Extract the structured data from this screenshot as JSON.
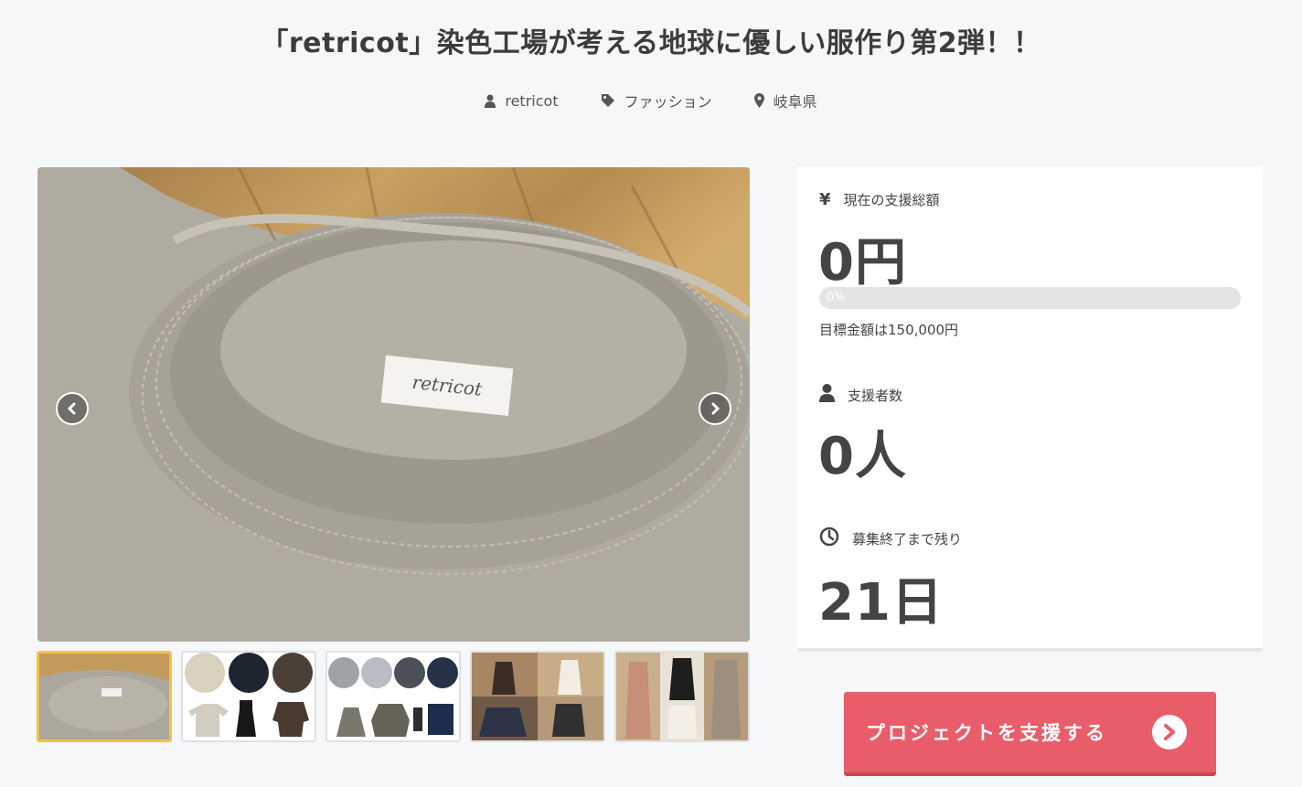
{
  "project": {
    "title": "「retricot」染色工場が考える地球に優しい服作り第2弾！！",
    "owner": "retricot",
    "category": "ファッション",
    "location": "岐阜県"
  },
  "gallery": {
    "label_text": "retricot",
    "prev_icon": "chevron-left-icon",
    "next_icon": "chevron-right-icon",
    "thumbnail_count": 5,
    "active_index": 0
  },
  "stats": {
    "amount_label": "現在の支援総額",
    "amount_icon": "¥",
    "amount_value": "0円",
    "progress_text": "0%",
    "progress_fraction": 0,
    "goal_text": "目標金額は150,000円",
    "backers_label": "支援者数",
    "backers_value": "0人",
    "remaining_label": "募集終了まで残り",
    "remaining_value": "21日"
  },
  "cta": {
    "label": "プロジェクトを支援する"
  },
  "colors": {
    "accent": "#e85d69",
    "active_thumb_border": "#f2c240",
    "background": "#f6f7f9"
  }
}
